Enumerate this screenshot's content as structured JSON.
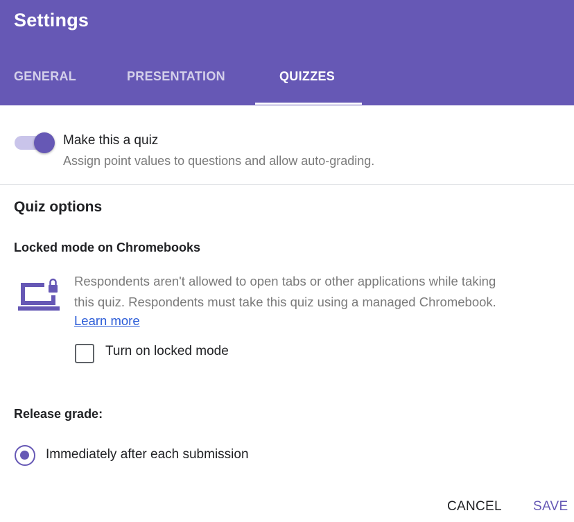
{
  "header": {
    "title": "Settings",
    "tabs": [
      {
        "label": "GENERAL",
        "active": false
      },
      {
        "label": "PRESENTATION",
        "active": false
      },
      {
        "label": "QUIZZES",
        "active": true
      }
    ]
  },
  "quiz_toggle": {
    "label": "Make this a quiz",
    "description": "Assign point values to questions and allow auto-grading.",
    "enabled": true
  },
  "quiz_options": {
    "title": "Quiz options",
    "locked_mode": {
      "heading": "Locked mode on Chromebooks",
      "description_line1": "Respondents aren't allowed to open tabs or other applications while taking",
      "description_line2": "this quiz. Respondents must take this quiz using a managed Chromebook.",
      "learn_more": "Learn more",
      "checkbox_label": "Turn on locked mode",
      "checked": false,
      "icon": "laptop-lock-icon"
    }
  },
  "release_grade": {
    "title": "Release grade:",
    "selected_option": "Immediately after each submission"
  },
  "footer": {
    "cancel_label": "CANCEL",
    "save_label": "SAVE"
  },
  "colors": {
    "accent": "#6658b5",
    "toggle_track": "#c9c4ea",
    "link": "#2a5bd7",
    "secondary_text": "#7a7a7a"
  }
}
